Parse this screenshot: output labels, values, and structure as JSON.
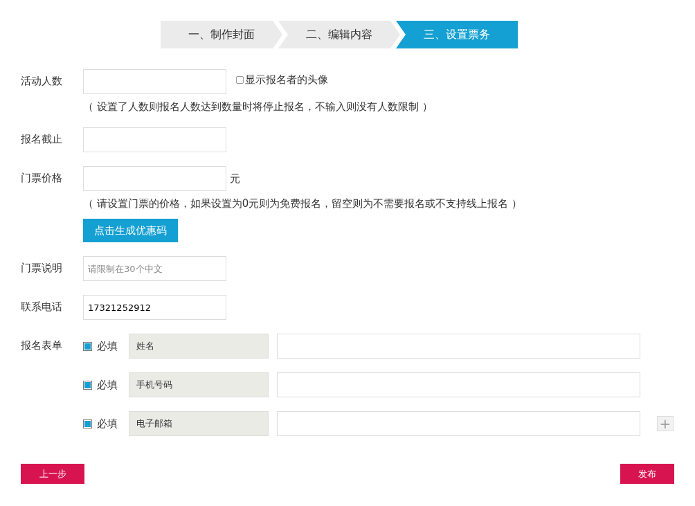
{
  "steps": [
    {
      "label": "一、制作封面",
      "selected": false
    },
    {
      "label": "二、编辑内容",
      "selected": false
    },
    {
      "label": "三、设置票务",
      "selected": true
    }
  ],
  "participants": {
    "label": "活动人数",
    "avatar_option": {
      "label": "显示报名者的头像",
      "checked": false
    },
    "hint": "（ 设置了人数则报名人数达到数量时将停止报名，不输入则没有人数限制 ）"
  },
  "deadline": {
    "label": "报名截止"
  },
  "price": {
    "label": "门票价格",
    "unit": "元",
    "hint": "（ 请设置门票的价格，如果设置为0元则为免费报名，留空则为不需要报名或不支持线上报名 ）",
    "coupon_button": "点击生成优惠码"
  },
  "ticket_note": {
    "label": "门票说明",
    "placeholder": "请限制在30个中文"
  },
  "phone": {
    "label": "联系电话",
    "value": "17321252912"
  },
  "form": {
    "label": "报名表单",
    "fields": [
      {
        "required_label": "必填",
        "required": true,
        "name": "姓名"
      },
      {
        "required_label": "必填",
        "required": true,
        "name": "手机号码"
      },
      {
        "required_label": "必填",
        "required": true,
        "name": "电子邮箱"
      }
    ],
    "add_button": "+"
  },
  "buttons": {
    "back": "上一步",
    "publish": "发布"
  }
}
